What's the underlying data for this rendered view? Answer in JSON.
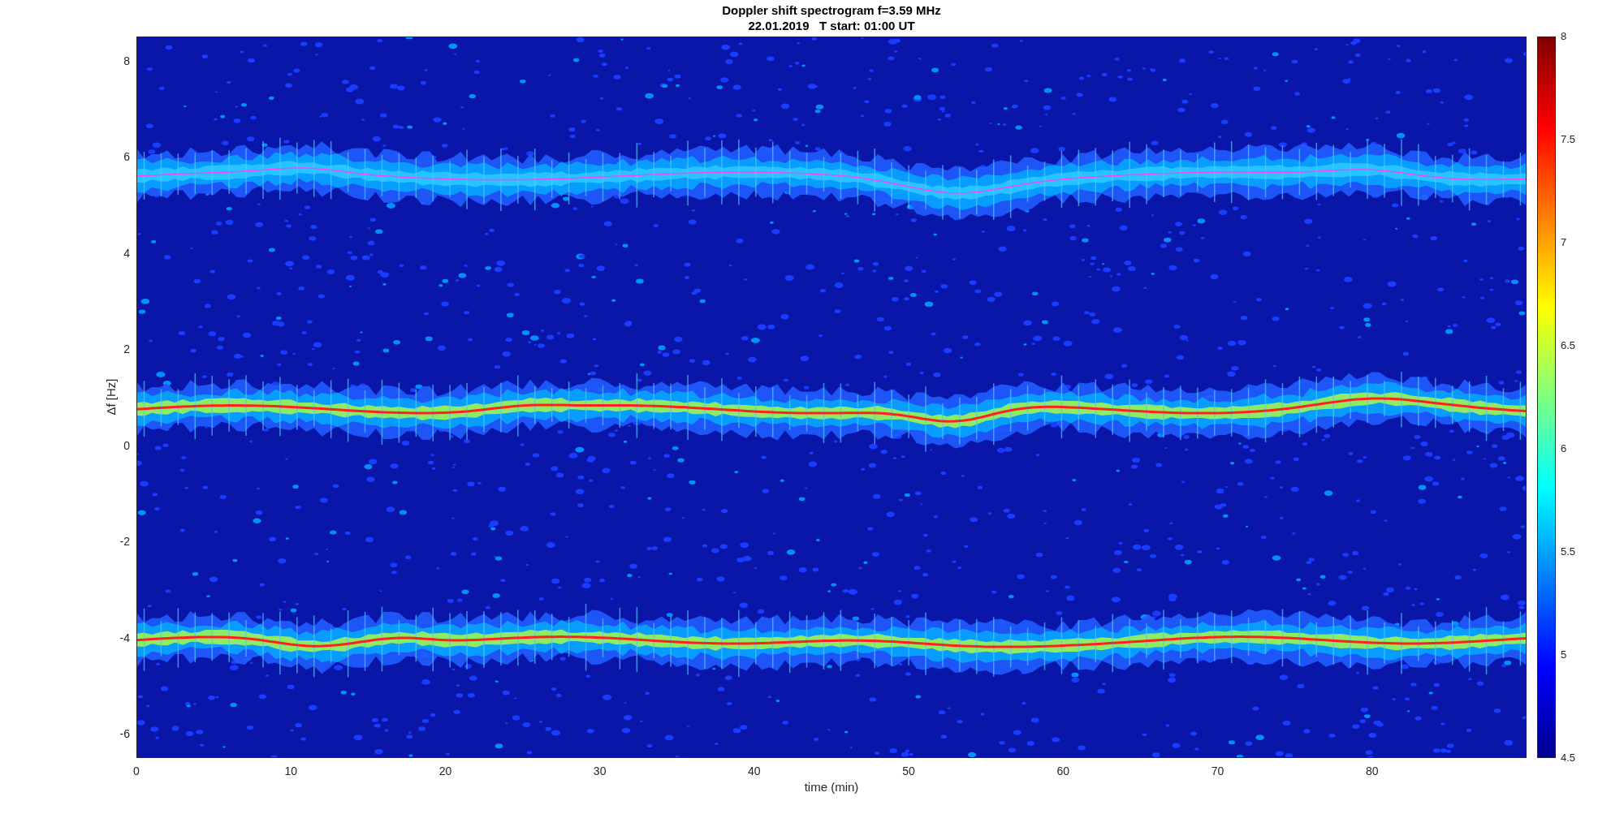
{
  "figure": {
    "title": [
      "Doppler shift spectrogram f=3.59 MHz",
      "22.01.2019   T start: 01:00 UT"
    ]
  },
  "axes": {
    "ylabel": "Δf [Hz]",
    "xlabel": "time (min)",
    "yticks": [
      "8",
      "6",
      "4",
      "2",
      "0",
      "-2",
      "-4",
      "-6"
    ],
    "xticks": [
      "0",
      "10",
      "20",
      "30",
      "40",
      "50",
      "60",
      "70",
      "80"
    ]
  },
  "colorbar": {
    "ticks": [
      "8",
      "7.5",
      "7",
      "6.5",
      "6",
      "5.5",
      "5",
      "4.5"
    ]
  }
}
